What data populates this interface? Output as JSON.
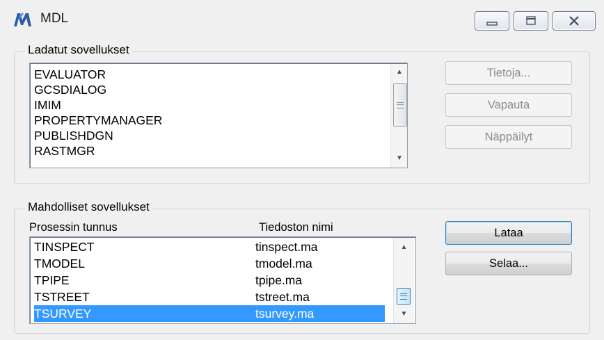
{
  "window": {
    "title": "MDL"
  },
  "loaded_group": {
    "label": "Ladatut sovellukset",
    "items": [
      "EVALUATOR",
      "GCSDIALOG",
      "IMIM",
      "PROPERTYMANAGER",
      "PUBLISHDGN",
      "RASTMGR"
    ]
  },
  "loaded_buttons": {
    "info": "Tietoja...",
    "unload": "Vapauta",
    "keyins": "Näppäilyt"
  },
  "available_group": {
    "label": "Mahdolliset sovellukset",
    "columns": [
      "Prosessin tunnus",
      "Tiedoston nimi"
    ],
    "rows": [
      {
        "name": "TINSPECT",
        "file": "tinspect.ma",
        "selected": false
      },
      {
        "name": "TMODEL",
        "file": "tmodel.ma",
        "selected": false
      },
      {
        "name": "TPIPE",
        "file": "tpipe.ma",
        "selected": false
      },
      {
        "name": "TSTREET",
        "file": "tstreet.ma",
        "selected": false
      },
      {
        "name": "TSURVEY",
        "file": "tsurvey.ma",
        "selected": true
      }
    ]
  },
  "available_buttons": {
    "load": "Lataa",
    "browse": "Selaa..."
  },
  "colors": {
    "selection": "#3399ff",
    "app_icon": "#2c5ea8"
  },
  "icons": {
    "app": "mdl-app-icon",
    "minimize": "minimize-icon",
    "maximize": "maximize-icon",
    "close": "close-icon",
    "scroll_up": "scroll-up-arrow-icon",
    "scroll_down": "scroll-down-arrow-icon"
  }
}
